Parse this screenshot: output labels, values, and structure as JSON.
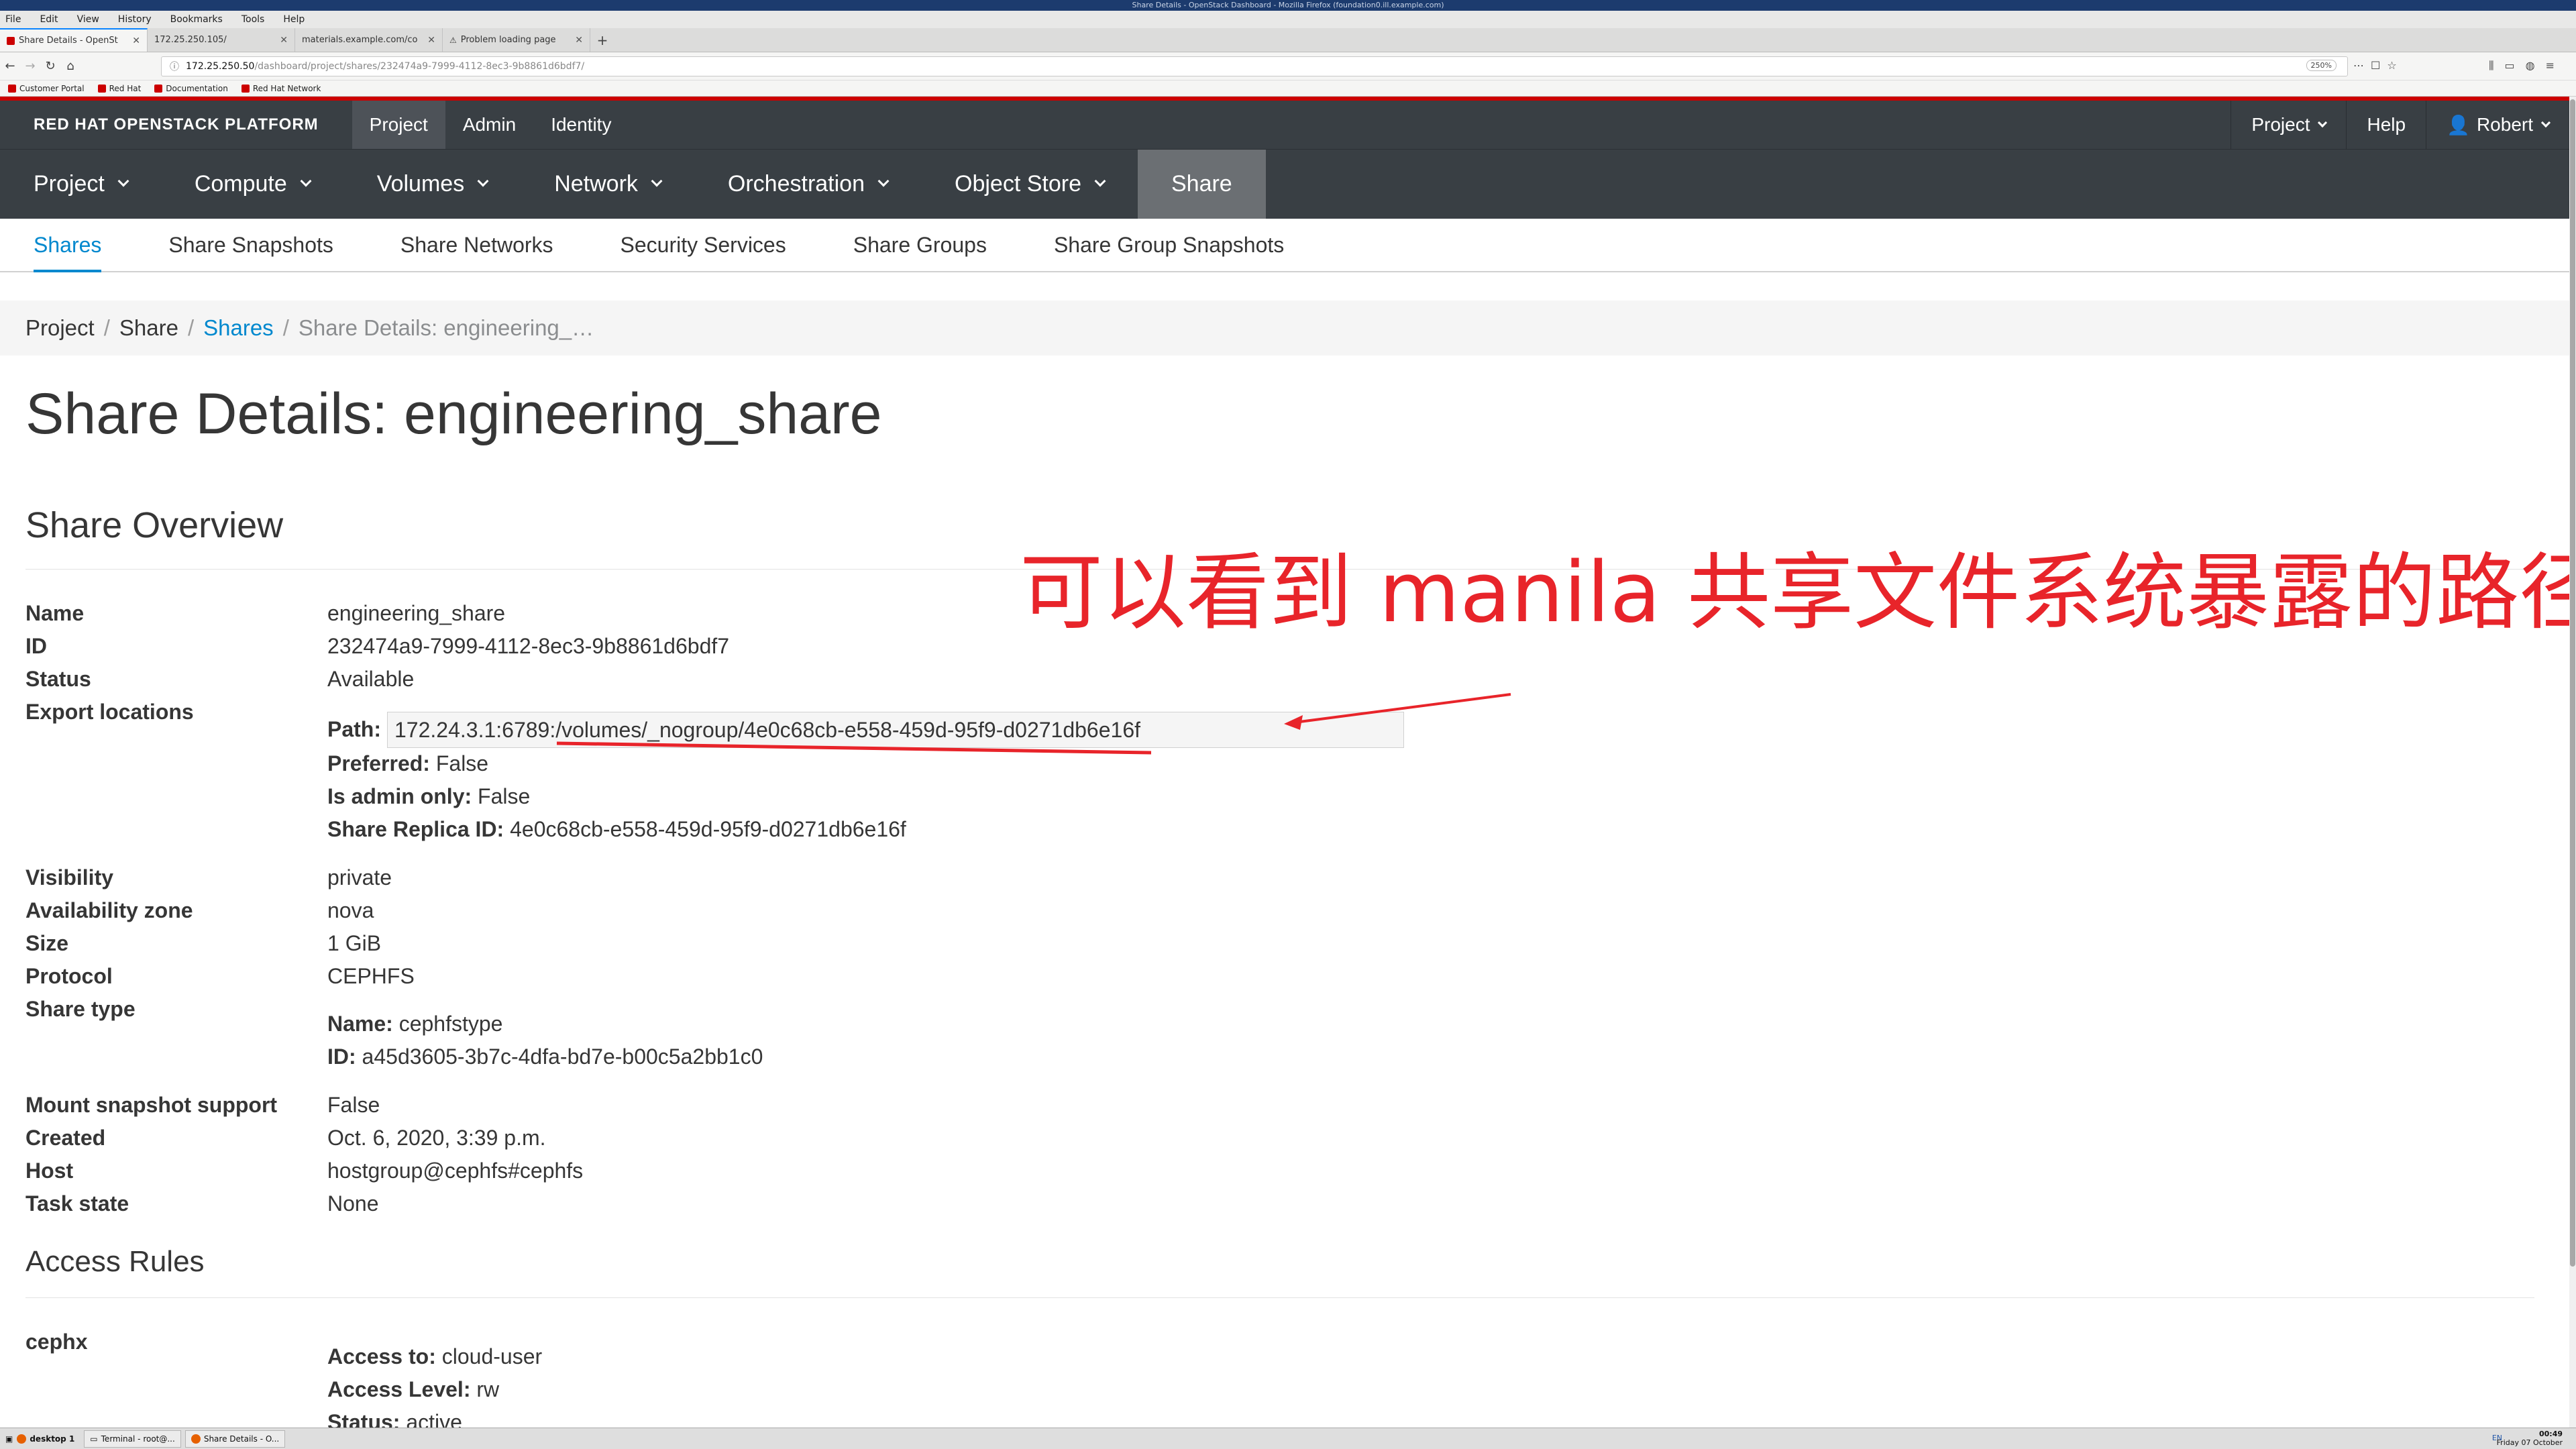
{
  "window": {
    "title": "Share Details - OpenStack Dashboard - Mozilla Firefox (foundation0.ill.example.com)"
  },
  "firefox": {
    "menu": [
      "File",
      "Edit",
      "View",
      "History",
      "Bookmarks",
      "Tools",
      "Help"
    ],
    "tabs": [
      {
        "label": "Share Details - OpenSt",
        "active": true,
        "icon": "redhat-favicon"
      },
      {
        "label": "172.25.250.105/",
        "active": false,
        "icon": ""
      },
      {
        "label": "materials.example.com/co",
        "active": false,
        "icon": ""
      },
      {
        "label": "Problem loading page",
        "active": false,
        "icon": "warning-icon"
      }
    ],
    "url_host": "172.25.250.50",
    "url_path": "/dashboard/project/shares/232474a9-7999-4112-8ec3-9b8861d6bdf7/",
    "zoom": "250%",
    "bookmarks": [
      "Customer Portal",
      "Red Hat",
      "Documentation",
      "Red Hat Network"
    ]
  },
  "header": {
    "brand": "RED HAT OPENSTACK PLATFORM",
    "top_links": [
      {
        "label": "Project",
        "active": true
      },
      {
        "label": "Admin",
        "active": false
      },
      {
        "label": "Identity",
        "active": false
      }
    ],
    "right": {
      "project": "Project",
      "help": "Help",
      "user": "Robert"
    }
  },
  "nav": [
    {
      "label": "Project",
      "dropdown": true,
      "active": false
    },
    {
      "label": "Compute",
      "dropdown": true,
      "active": false
    },
    {
      "label": "Volumes",
      "dropdown": true,
      "active": false
    },
    {
      "label": "Network",
      "dropdown": true,
      "active": false
    },
    {
      "label": "Orchestration",
      "dropdown": true,
      "active": false
    },
    {
      "label": "Object Store",
      "dropdown": true,
      "active": false
    },
    {
      "label": "Share",
      "dropdown": false,
      "active": true
    }
  ],
  "subnav": [
    {
      "label": "Shares",
      "active": true
    },
    {
      "label": "Share Snapshots",
      "active": false
    },
    {
      "label": "Share Networks",
      "active": false
    },
    {
      "label": "Security Services",
      "active": false
    },
    {
      "label": "Share Groups",
      "active": false
    },
    {
      "label": "Share Group Snapshots",
      "active": false
    }
  ],
  "breadcrumb": [
    "Project",
    "Share",
    "Shares",
    "Share Details: engineering_…"
  ],
  "page_title": "Share Details: engineering_share",
  "overview": {
    "heading": "Share Overview",
    "name_label": "Name",
    "name": "engineering_share",
    "id_label": "ID",
    "id": "232474a9-7999-4112-8ec3-9b8861d6bdf7",
    "status_label": "Status",
    "status": "Available",
    "export_label": "Export locations",
    "path_label": "Path:",
    "path": "172.24.3.1:6789:/volumes/_nogroup/4e0c68cb-e558-459d-95f9-d0271db6e16f",
    "preferred_label": "Preferred:",
    "preferred": "False",
    "admin_only_label": "Is admin only:",
    "admin_only": "False",
    "replica_label": "Share Replica ID:",
    "replica": "4e0c68cb-e558-459d-95f9-d0271db6e16f",
    "visibility_label": "Visibility",
    "visibility": "private",
    "az_label": "Availability zone",
    "az": "nova",
    "size_label": "Size",
    "size": "1 GiB",
    "protocol_label": "Protocol",
    "protocol": "CEPHFS",
    "share_type_label": "Share type",
    "st_name_label": "Name:",
    "st_name": "cephfstype",
    "st_id_label": "ID:",
    "st_id": "a45d3605-3b7c-4dfa-bd7e-b00c5a2bb1c0",
    "mount_label": "Mount snapshot support",
    "mount": "False",
    "created_label": "Created",
    "created": "Oct. 6, 2020, 3:39 p.m.",
    "host_label": "Host",
    "host": "hostgroup@cephfs#cephfs",
    "task_label": "Task state",
    "task": "None"
  },
  "access": {
    "heading": "Access Rules",
    "rule_name": "cephx",
    "access_to_label": "Access to:",
    "access_to": "cloud-user",
    "access_level_label": "Access Level:",
    "access_level": "rw",
    "status_label": "Status:",
    "status": "active"
  },
  "annotation": {
    "text": "可以看到 manila 共享文件系统暴露的路径",
    "color": "#e8242a"
  },
  "taskbar": {
    "items": [
      "desktop 1",
      "Terminal - root@...",
      "Share Details - O..."
    ],
    "lang": "EN",
    "time": "00:49",
    "date": "Friday 07 October"
  },
  "colors": {
    "accent": "#0088ce",
    "brand_red": "#cc0000",
    "header_bg": "#393f44"
  }
}
